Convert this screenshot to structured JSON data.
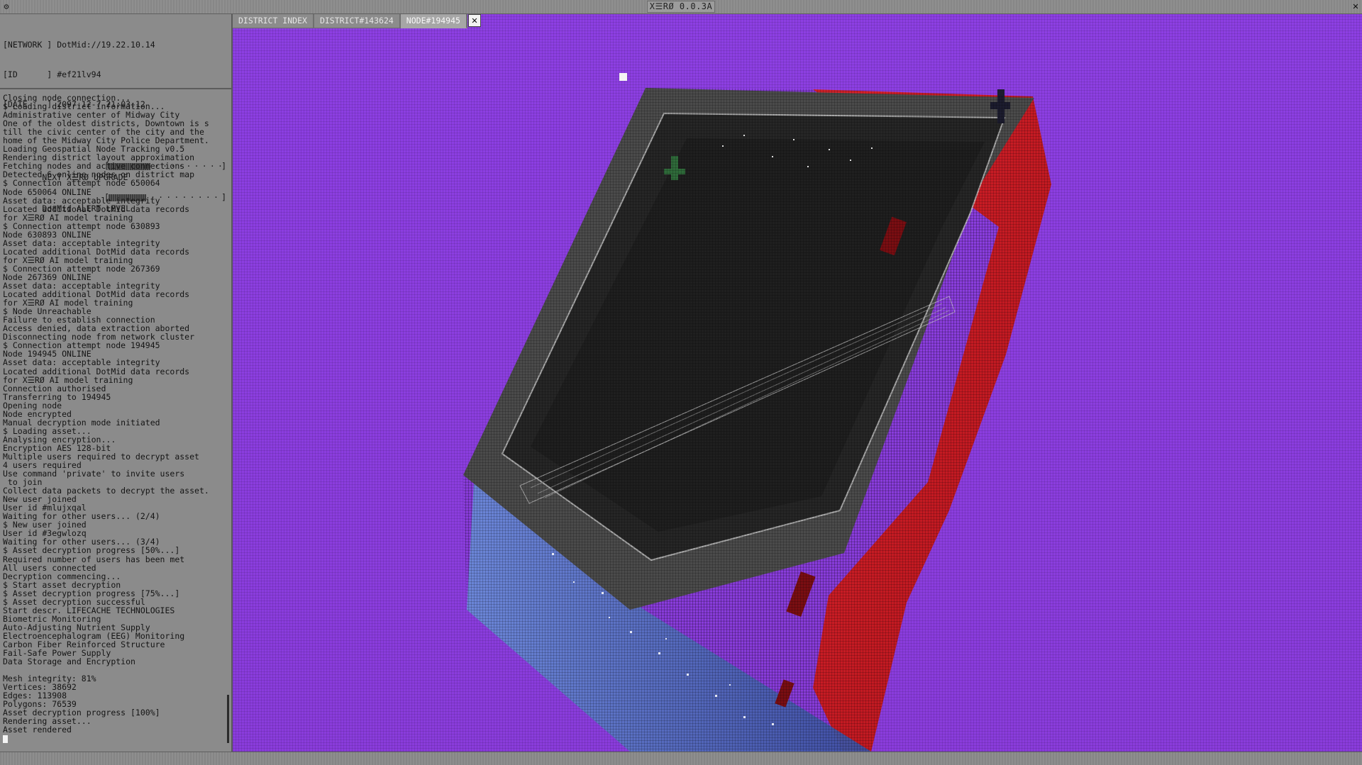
{
  "window": {
    "title": "X☰RØ 0.0.3A",
    "system_menu_icon": "gear-icon",
    "close_icon": "close-icon",
    "close_glyph": "✕"
  },
  "header": {
    "network_label": "[NETWORK ]",
    "network_value": "DotMid://19.22.10.14",
    "id_label": "[ID      ]",
    "id_value": "#ef21lv94",
    "date_label": "[DATE    ]",
    "date_value": "2097-12-7 21:03:12"
  },
  "meters": {
    "upgrade_label": "NEXT X☰RØ UPGRADE",
    "upgrade_fraction": 0.37,
    "alert_label": "DotMid ALERT LEVEL",
    "alert_fraction": 0.33
  },
  "tabs": [
    {
      "label": "DISTRICT INDEX",
      "active": false
    },
    {
      "label": "DISTRICT#143624",
      "active": false
    },
    {
      "label": "NODE#194945",
      "active": true
    }
  ],
  "tab_close_glyph": "✕",
  "colors": {
    "viewport_bg": "#8c3ee0",
    "asset_side": "#cc1a22",
    "asset_top": "#2a2a2a",
    "asset_base": "#5a73c8"
  },
  "log": [
    "Closing node connection...",
    "$ Loading district information...",
    "Administrative center of Midway City",
    "One of the oldest districts, Downtown is s",
    "till the civic center of the city and the",
    "home of the Midway City Police Department.",
    "Loading Geospatial Node Tracking v0.5",
    "Rendering district layout approximation",
    "Fetching nodes and active connections",
    "Detected 6 online nodes on district map",
    "$ Connection attempt node 650064",
    "Node 650064 ONLINE",
    "Asset data: acceptable integrity",
    "Located additional DotMid data records",
    "for X☰RØ AI model training",
    "$ Connection attempt node 630893",
    "Node 630893 ONLINE",
    "Asset data: acceptable integrity",
    "Located additional DotMid data records",
    "for X☰RØ AI model training",
    "$ Connection attempt node 267369",
    "Node 267369 ONLINE",
    "Asset data: acceptable integrity",
    "Located additional DotMid data records",
    "for X☰RØ AI model training",
    "$ Node Unreachable",
    "Failure to establish connection",
    "Access denied, data extraction aborted",
    "Disconnecting node from network cluster",
    "$ Connection attempt node 194945",
    "Node 194945 ONLINE",
    "Asset data: acceptable integrity",
    "Located additional DotMid data records",
    "for X☰RØ AI model training",
    "Connection authorised",
    "Transferring to 194945",
    "Opening node",
    "Node encrypted",
    "Manual decryption mode initiated",
    "$ Loading asset...",
    "Analysing encryption...",
    "Encryption AES 128-bit",
    "Multiple users required to decrypt asset",
    "4 users required",
    "Use command 'private' to invite users",
    " to join",
    "Collect data packets to decrypt the asset.",
    "New user joined",
    "User id #mlujxqal",
    "Waiting for other users... (2/4)",
    "$ New user joined",
    "User id #3egwlozq",
    "Waiting for other users... (3/4)",
    "$ Asset decryption progress [50%...]",
    "Required number of users has been met",
    "All users connected",
    "Decryption commencing...",
    "$ Start asset decryption",
    "$ Asset decryption progress [75%...]",
    "$ Asset decryption successful",
    "Start descr. LIFECACHE TECHNOLOGIES",
    "Biometric Monitoring",
    "Auto-Adjusting Nutrient Supply",
    "Electroencephalogram (EEG) Monitoring",
    "Carbon Fiber Reinforced Structure",
    "Fail-Safe Power Supply",
    "Data Storage and Encryption",
    "",
    "Mesh integrity: 81%",
    "Vertices: 38692",
    "Edges: 113908",
    "Polygons: 76539",
    "Asset decryption progress [100%]",
    "Rendering asset...",
    "Asset rendered"
  ]
}
